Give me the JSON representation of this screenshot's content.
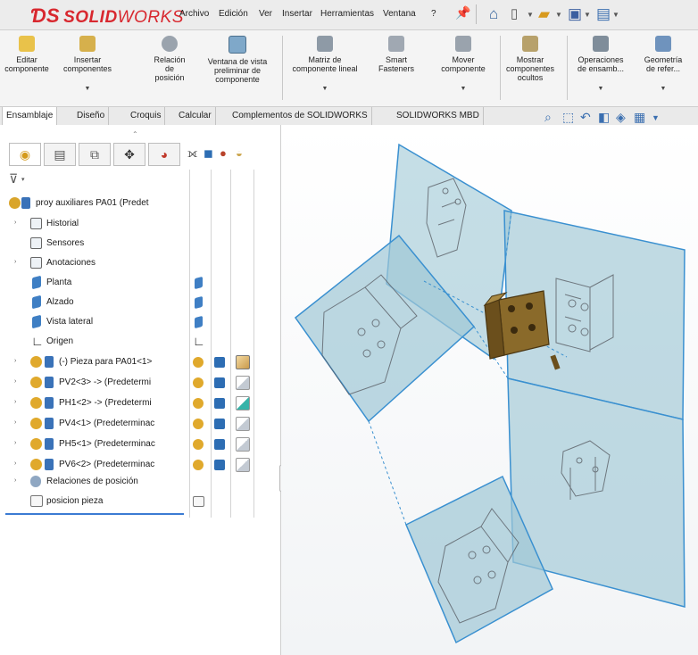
{
  "app": {
    "logo_ds": "ƊS",
    "logo_solid": "SOLID",
    "logo_works": "WORKS"
  },
  "menu": [
    "Archivo",
    "Edición",
    "Ver",
    "Insertar",
    "Herramientas",
    "Ventana",
    "?"
  ],
  "ribbon": {
    "commands": [
      {
        "line1": "Editar",
        "line2": "componente",
        "line3": ""
      },
      {
        "line1": "Insertar",
        "line2": "componentes",
        "line3": ""
      },
      {
        "line1": "Relación",
        "line2": "de",
        "line3": "posición"
      },
      {
        "line1": "Ventana de vista",
        "line2": "preliminar de",
        "line3": "componente"
      },
      {
        "line1": "Matriz de",
        "line2": "componente lineal",
        "line3": ""
      },
      {
        "line1": "Smart",
        "line2": "Fasteners",
        "line3": ""
      },
      {
        "line1": "Mover",
        "line2": "componente",
        "line3": ""
      },
      {
        "line1": "Mostrar",
        "line2": "componentes",
        "line3": "ocultos"
      },
      {
        "line1": "Operaciones",
        "line2": "de ensamb...",
        "line3": ""
      },
      {
        "line1": "Geometría",
        "line2": "de refer...",
        "line3": ""
      }
    ]
  },
  "tabs": [
    "Ensamblaje",
    "Diseño",
    "Croquis",
    "Calcular",
    "Complementos de SOLIDWORKS",
    "SOLIDWORKS MBD"
  ],
  "tree": {
    "root": "proy auxiliares PA01  (Predet",
    "items": [
      {
        "label": "Historial"
      },
      {
        "label": "Sensores"
      },
      {
        "label": "Anotaciones"
      },
      {
        "label": "Planta"
      },
      {
        "label": "Alzado"
      },
      {
        "label": "Vista lateral"
      },
      {
        "label": "Origen"
      },
      {
        "label": "(-) Pieza para PA01<1>"
      },
      {
        "label": "PV2<3> -> (Predetermi"
      },
      {
        "label": "PH1<2> -> (Predetermi"
      },
      {
        "label": "PV4<1> (Predeterminac"
      },
      {
        "label": "PH5<1> (Predeterminac"
      },
      {
        "label": "PV6<2> (Predeterminac"
      },
      {
        "label": "Relaciones de posición"
      },
      {
        "label": "posicion pieza"
      }
    ]
  },
  "colors": {
    "plane_fill": "#9fc8d6",
    "plane_stroke": "#3a90d0",
    "part_fill": "#8a6a2a",
    "accent": "#3b7bd3"
  }
}
